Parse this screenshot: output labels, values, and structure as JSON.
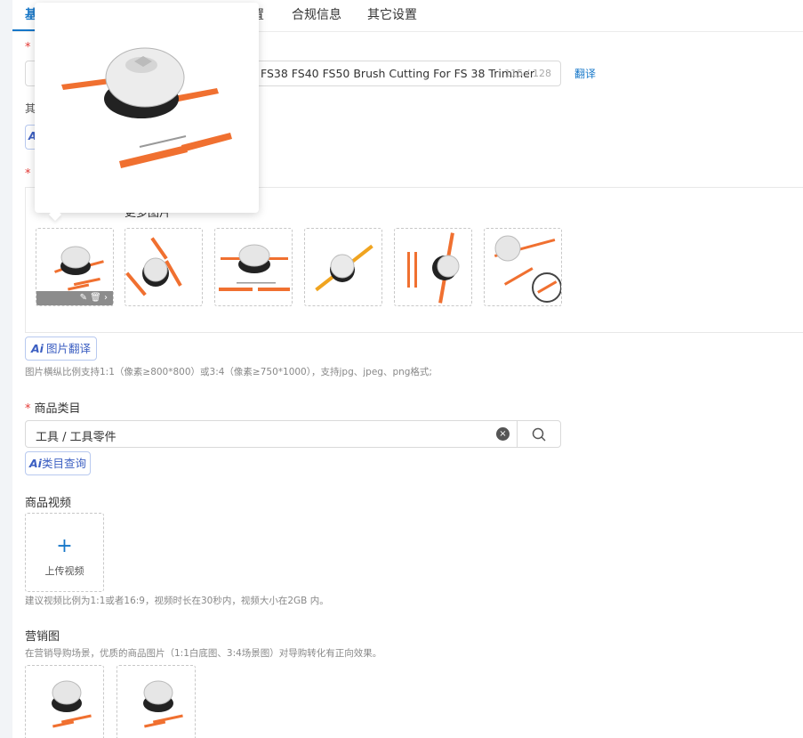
{
  "tabs": [
    {
      "label": "基"
    },
    {
      "label": "置"
    },
    {
      "label": "合规信息"
    },
    {
      "label": "其它设置"
    }
  ],
  "title_field": {
    "required_mark": "*",
    "value": "FS38 FS40 FS50 Brush Cutting For FS 38 Trimmer",
    "count": "115 / 128",
    "translate": "翻译"
  },
  "partial_label": "其",
  "images_section": {
    "required_mark": "*",
    "sub_tab": "更多图片",
    "thumbnails": [
      {
        "name": "main-image",
        "toolbar": "✎ 🗑 ›"
      },
      {
        "name": "image-2"
      },
      {
        "name": "image-3"
      },
      {
        "name": "image-4"
      },
      {
        "name": "image-5"
      },
      {
        "name": "image-6"
      }
    ],
    "ai_translate": {
      "mark": "Ai",
      "label": "图片翻译"
    },
    "hint": "图片横纵比例支持1:1（像素≥800*800）或3:4（像素≥750*1000），支持jpg、jpeg、png格式;"
  },
  "category": {
    "required_mark": "*",
    "label": "商品类目",
    "value": "工具 / 工具零件",
    "ai_query": {
      "mark": "Ai",
      "label": "类目查询"
    }
  },
  "video": {
    "label": "商品视频",
    "upload_plus": "+",
    "upload_label": "上传视频",
    "hint": "建议视频比例为1:1或者16:9，视频时长在30秒内，视频大小在2GB 内。"
  },
  "marketing": {
    "label": "营销图",
    "hint": "在营销导购场景，优质的商品图片（1:1白底图、3:4场景图）对导购转化有正向效果。"
  },
  "colors": {
    "accent": "#1677c9",
    "ai": "#3c5fc2",
    "required": "#e53935",
    "product_orange": "#f07030"
  }
}
